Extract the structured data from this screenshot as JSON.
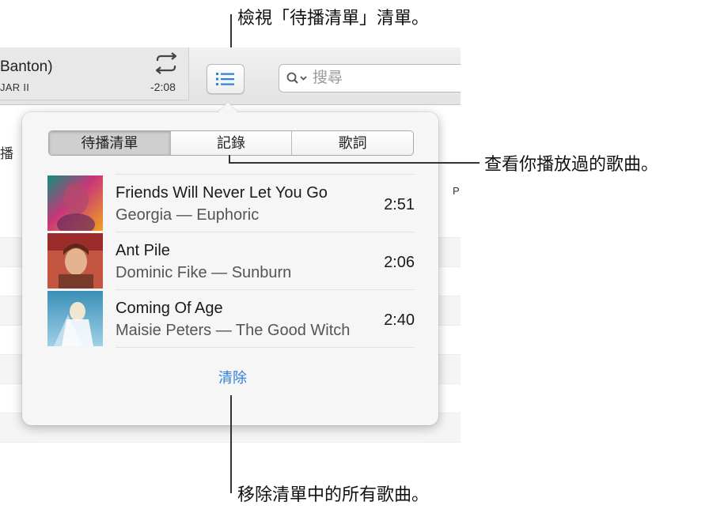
{
  "callouts": {
    "queue": "檢視「待播清單」清單。",
    "history": "查看你播放過的歌曲。",
    "clear": "移除清單中的所有歌曲。"
  },
  "now_playing": {
    "title_partial": "Banton)",
    "subtitle_partial": "JAR II",
    "time_remaining": "-2:08"
  },
  "search": {
    "placeholder": "搜尋"
  },
  "list": {
    "column_header_partial": "播",
    "column_p": "P"
  },
  "popover": {
    "tabs": [
      {
        "label": "待播清單",
        "active": true
      },
      {
        "label": "記錄",
        "active": false
      },
      {
        "label": "歌詞",
        "active": false
      }
    ],
    "tracks": [
      {
        "title": "Friends Will Never Let You Go",
        "subtitle": "Georgia — Euphoric",
        "duration": "2:51"
      },
      {
        "title": "Ant Pile",
        "subtitle": "Dominic Fike — Sunburn",
        "duration": "2:06"
      },
      {
        "title": "Coming Of Age",
        "subtitle": "Maisie Peters — The Good Witch",
        "duration": "2:40"
      }
    ],
    "clear_label": "清除"
  },
  "colors": {
    "accent": "#2f7fdc",
    "popover_bg": "#f6f6f6"
  }
}
